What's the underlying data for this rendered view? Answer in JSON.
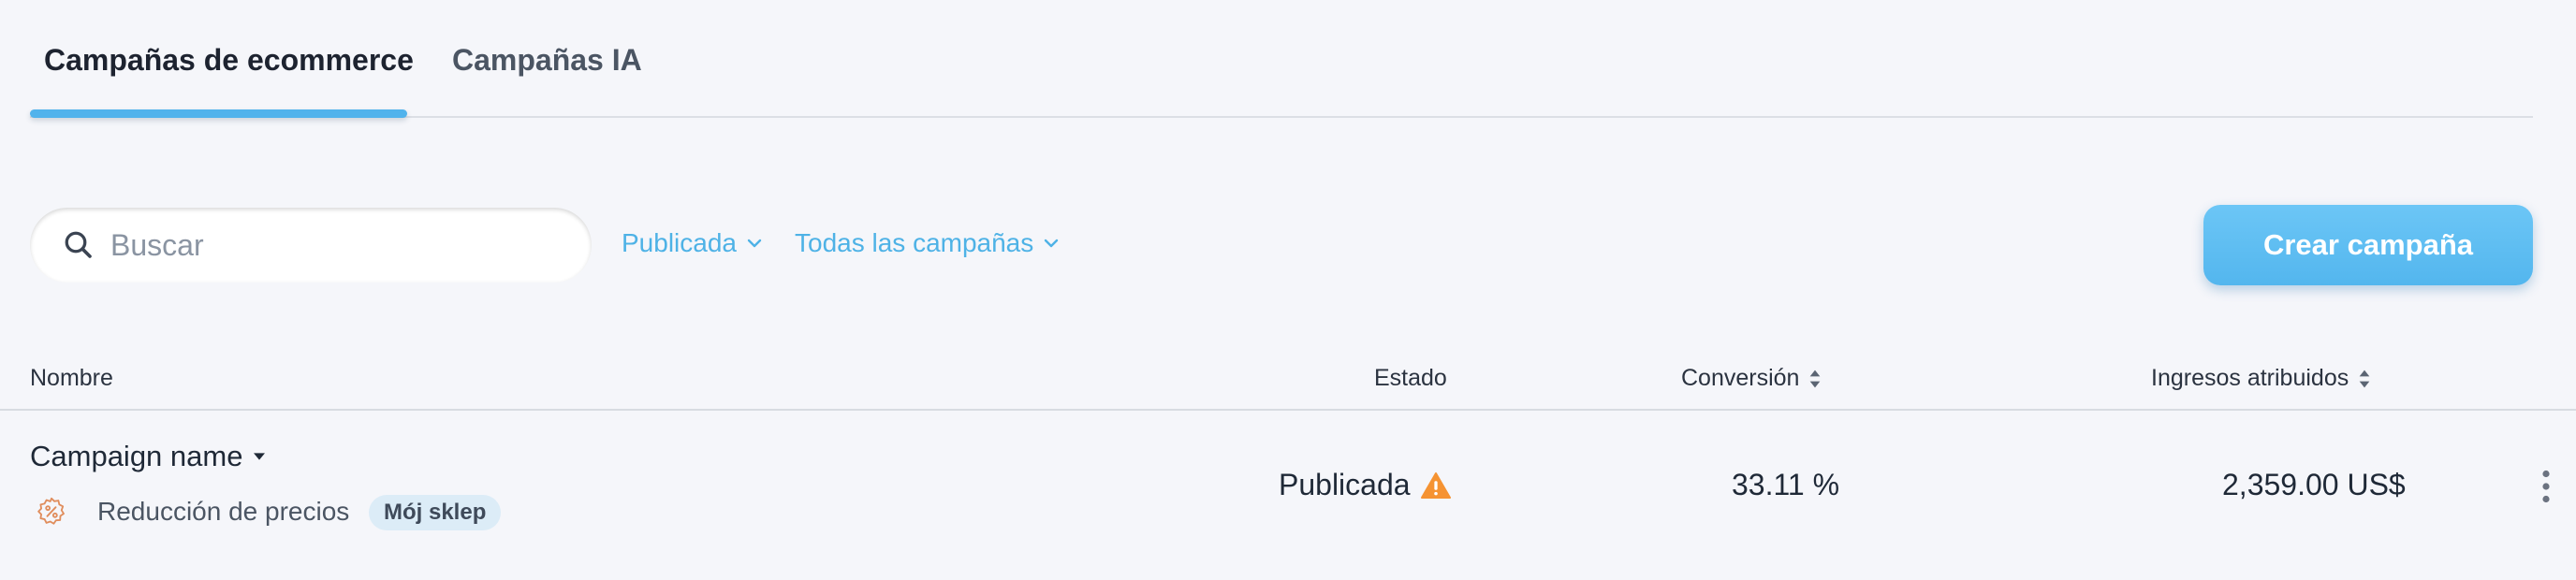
{
  "tabs": [
    {
      "label": "Campañas de ecommerce",
      "active": true
    },
    {
      "label": "Campañas IA",
      "active": false
    }
  ],
  "toolbar": {
    "search_placeholder": "Buscar",
    "search_value": "",
    "filter_status": "Publicada",
    "filter_campaigns": "Todas las campañas",
    "create_label": "Crear campaña"
  },
  "table": {
    "columns": {
      "name": "Nombre",
      "status": "Estado",
      "conversion": "Conversión",
      "revenue": "Ingresos atribuidos"
    },
    "rows": [
      {
        "name": "Campaign name",
        "type": "Reducción de precios",
        "type_icon": "discount-badge-icon",
        "store": "Mój sklep",
        "status": "Publicada",
        "status_icon": "warning-icon",
        "conversion": "33.11 %",
        "revenue": "2,359.00 US$"
      }
    ]
  },
  "colors": {
    "accent": "#4eb2e6",
    "button": "#5ab9ef",
    "warning": "#f59332",
    "badge_bg": "#dcecf7",
    "background": "#f5f6fa"
  }
}
